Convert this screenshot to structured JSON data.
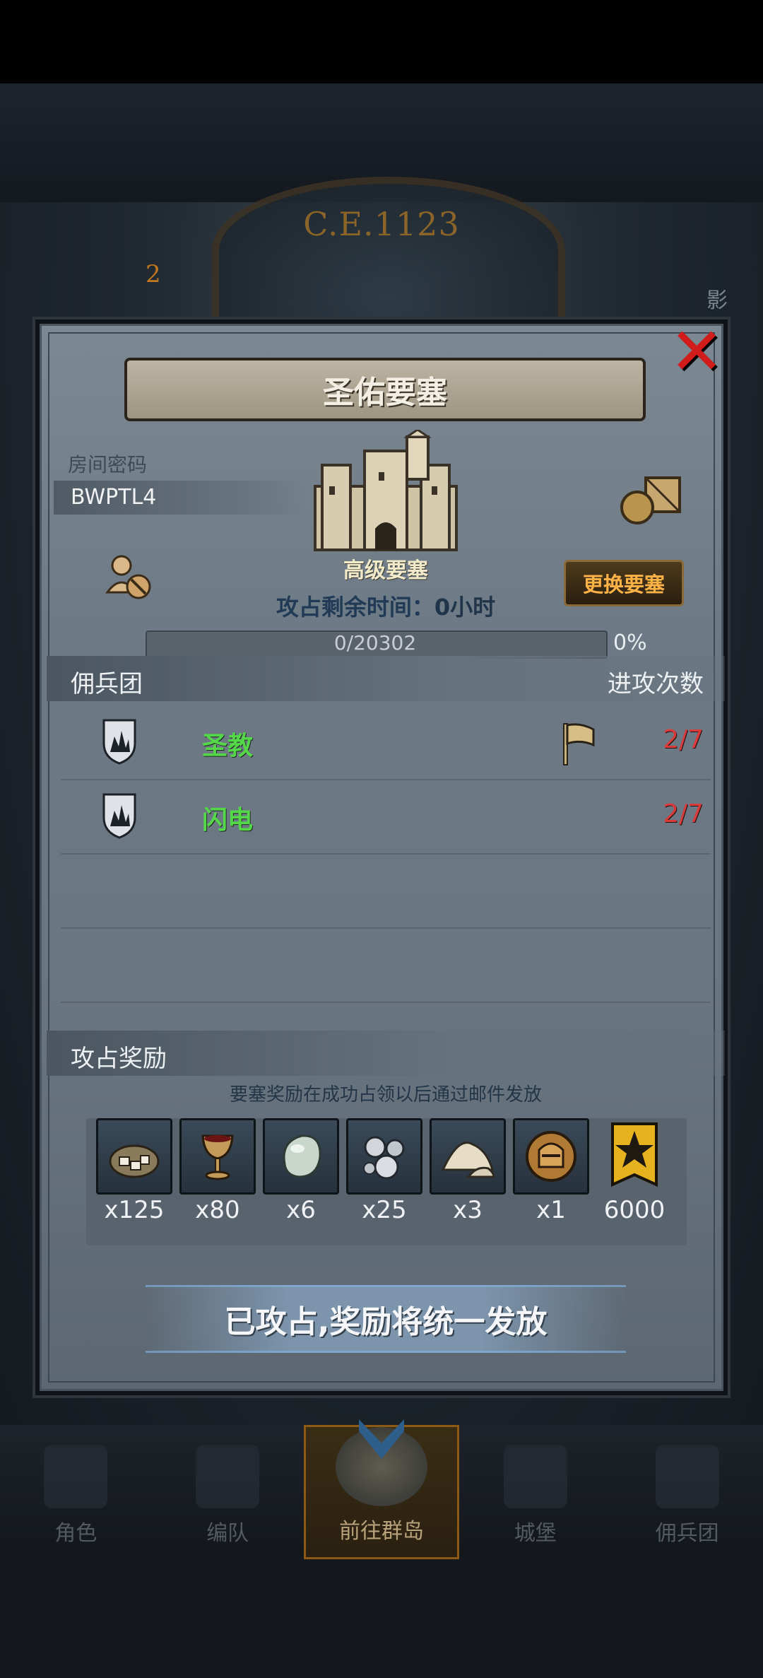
{
  "background": {
    "era_label": "C.E.1123",
    "orange_digit": "2",
    "side_text": "影"
  },
  "modal": {
    "title": "圣佑要塞",
    "close_icon": "close-icon",
    "room_label": "房间密码",
    "room_code": "BWPTL4",
    "fortress_level": "高级要塞",
    "change_button": "更换要塞",
    "time_label": "攻占剩余时间：",
    "time_value": "0小时",
    "progress": {
      "text": "0/20302",
      "percent_label": "0%",
      "fraction": 0
    },
    "mercenary_section": {
      "left": "佣兵团",
      "right": "进攻次数"
    },
    "mercenaries": [
      {
        "name": "圣教",
        "count": "2/7",
        "flag": true
      },
      {
        "name": "闪电",
        "count": "2/7",
        "flag": false
      }
    ],
    "rewards_section": {
      "left": "攻占奖励"
    },
    "rewards_note": "要塞奖励在成功占领以后通过邮件发放",
    "rewards": [
      {
        "icon": "stone-pile-icon",
        "qty": "x125"
      },
      {
        "icon": "goblet-icon",
        "qty": "x80"
      },
      {
        "icon": "gem-icon",
        "qty": "x6"
      },
      {
        "icon": "silver-ore-icon",
        "qty": "x25"
      },
      {
        "icon": "sand-pile-icon",
        "qty": "x3"
      },
      {
        "icon": "knight-helmet-icon",
        "qty": "x1"
      },
      {
        "icon": "gold-banner-icon",
        "qty": "6000"
      }
    ],
    "claim_status": "已攻占,奖励将统一发放"
  },
  "bottom_nav": {
    "items": [
      {
        "label": "角色",
        "icon": "knight-icon"
      },
      {
        "label": "编队",
        "icon": "helmet-icon"
      },
      {
        "label": "前往群岛",
        "icon": "globe-icon",
        "active": true
      },
      {
        "label": "城堡",
        "icon": "castle-icon"
      },
      {
        "label": "佣兵团",
        "icon": "ship-icon"
      }
    ]
  },
  "colors": {
    "accent_orange": "#ffb347",
    "green_name": "#54d84a",
    "red_count": "#d93a3a"
  }
}
